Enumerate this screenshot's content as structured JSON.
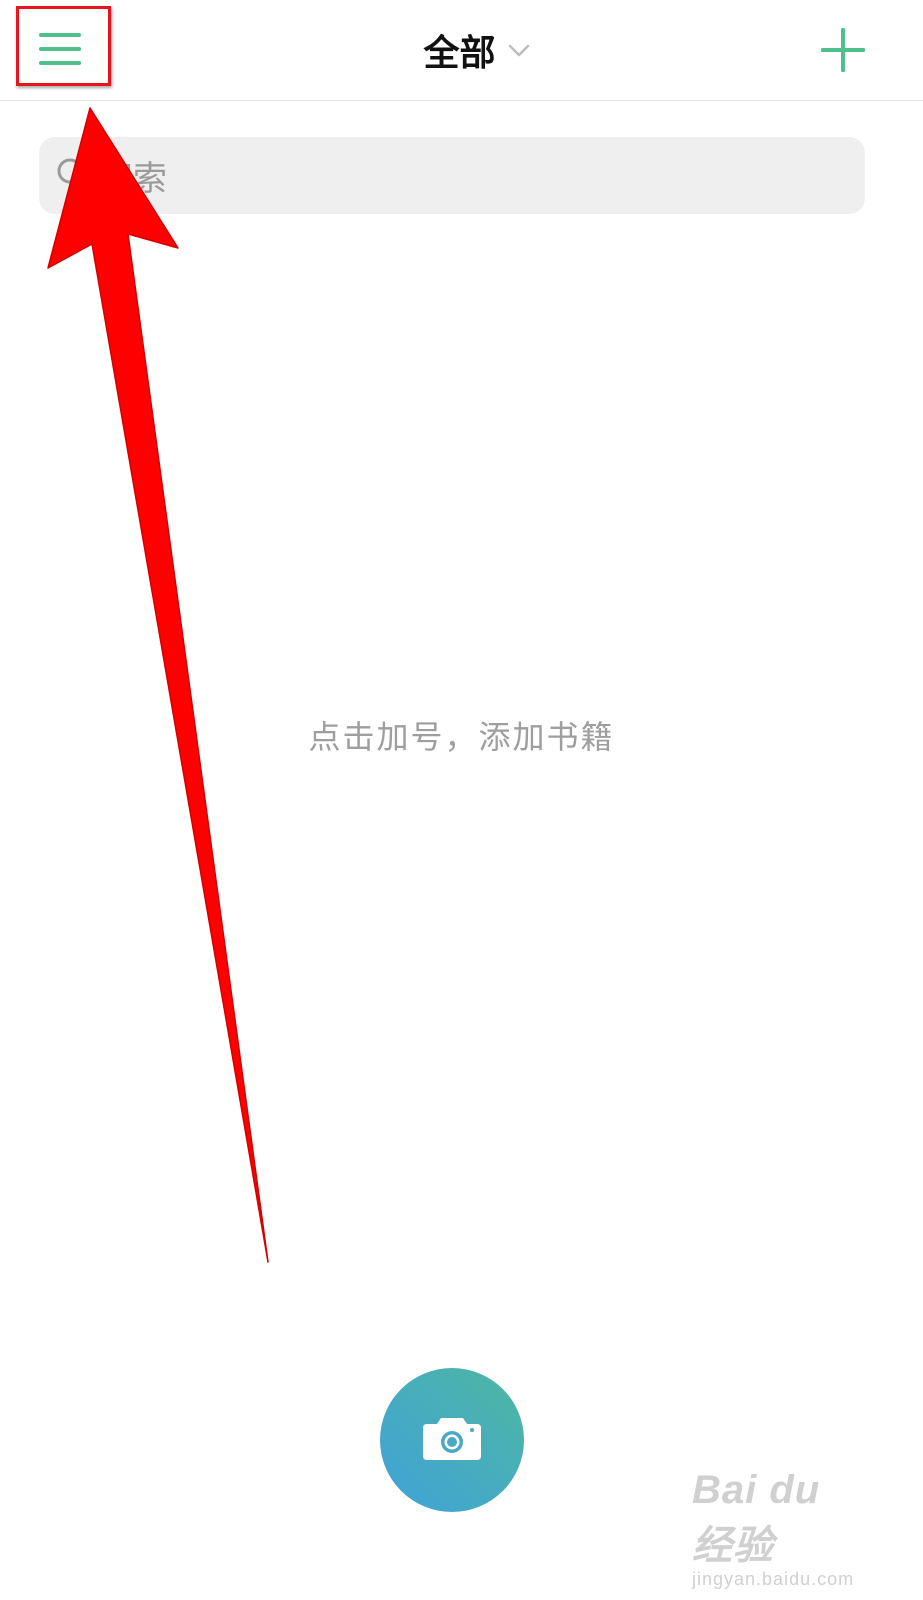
{
  "header": {
    "title": "全部",
    "menu_icon": "hamburger-menu-icon",
    "dropdown_icon": "chevron-down-icon",
    "add_icon": "plus-icon"
  },
  "search": {
    "placeholder": "搜索",
    "icon": "search-icon"
  },
  "empty_state": {
    "hint": "点击加号，添加书籍"
  },
  "camera_button": {
    "icon": "camera-icon"
  },
  "annotation": {
    "arrow_color": "#ff0000",
    "highlight_color": "#e8141c"
  },
  "watermark": {
    "main": "Bai du 经验",
    "sub": "jingyan.baidu.com"
  },
  "colors": {
    "accent_green": "#4fbf8b",
    "camera_gradient_start": "#3fa2d9",
    "camera_gradient_end": "#4fb7a2"
  }
}
